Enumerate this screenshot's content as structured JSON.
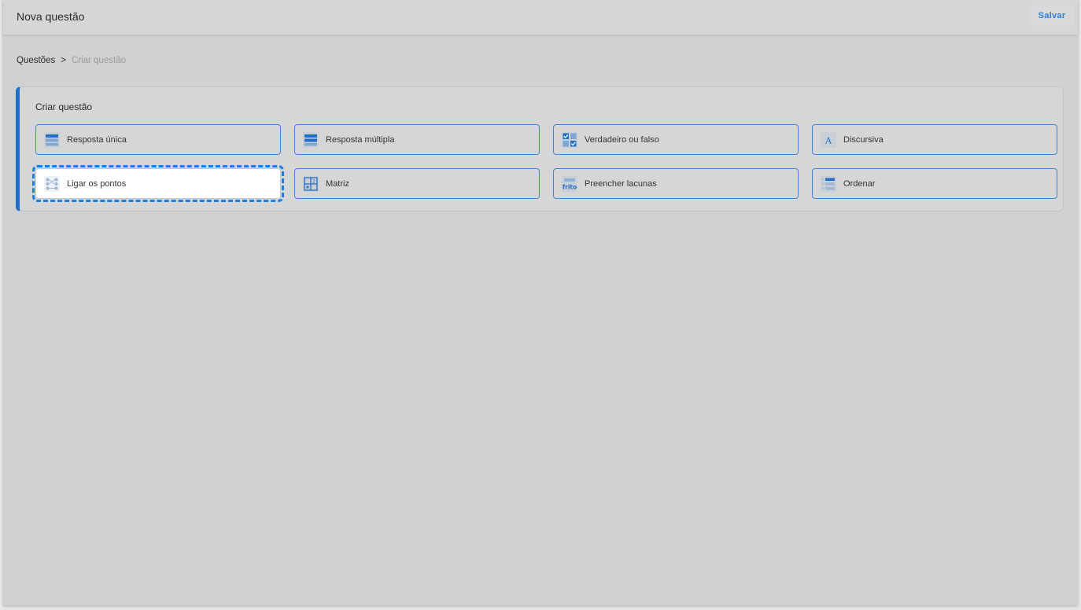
{
  "header": {
    "title": "Nova questão",
    "save_label": "Salvar"
  },
  "breadcrumb": {
    "link": "Questões",
    "separator": ">",
    "current": "Criar questão"
  },
  "card": {
    "title": "Criar questão",
    "options": [
      {
        "label": "Resposta única",
        "icon": "single-answer-icon"
      },
      {
        "label": "Resposta múltipla",
        "icon": "multiple-answer-icon"
      },
      {
        "label": "Verdadeiro ou falso",
        "icon": "true-false-icon"
      },
      {
        "label": "Discursiva",
        "icon": "essay-icon"
      },
      {
        "label": "Ligar os pontos",
        "icon": "connect-dots-icon",
        "selected": true
      },
      {
        "label": "Matriz",
        "icon": "matrix-icon"
      },
      {
        "label": "Preencher lacunas",
        "icon": "fill-blanks-icon"
      },
      {
        "label": "Ordenar",
        "icon": "ordering-icon"
      }
    ]
  },
  "colors": {
    "accent": "#1f6fc6",
    "option_border": "#3f86d4",
    "focus_outline": "#1c7ee0",
    "save_text": "#2f7fd1"
  }
}
